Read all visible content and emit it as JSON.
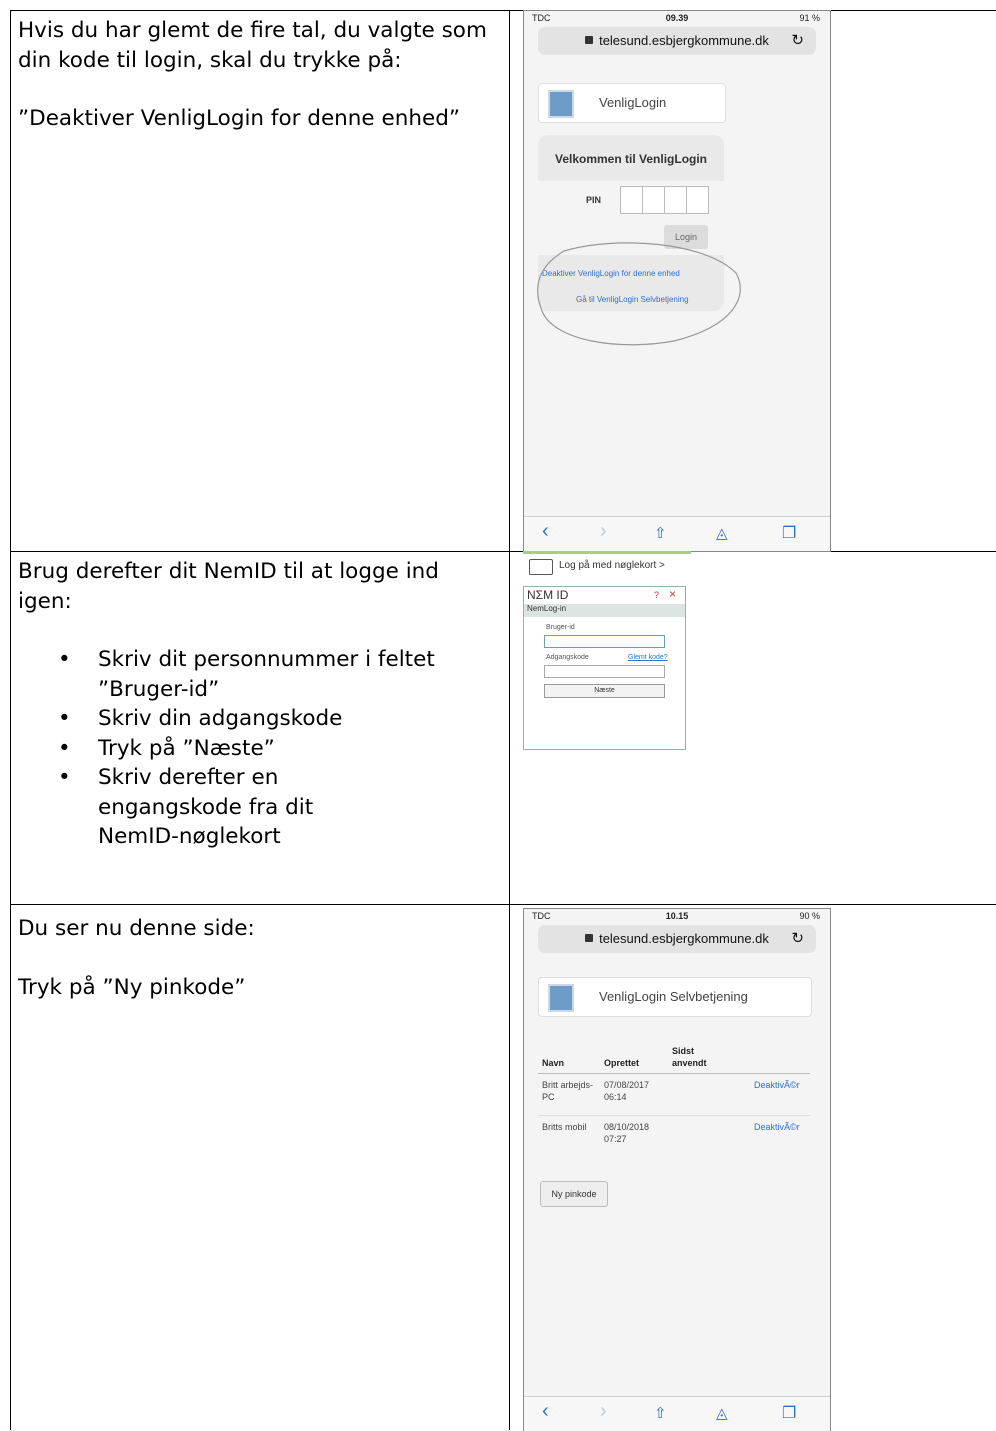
{
  "rows": [
    {
      "text_paragraphs": [
        "Hvis du har glemt de fire tal, du valgte som din kode til login, skal du trykke på:",
        "”Deaktiver VenligLogin for denne enhed”"
      ]
    },
    {
      "intro": "Brug derefter dit NemID til at logge ind igen:",
      "bullets": [
        "Skriv dit personnummer i feltet ”Bruger-id”",
        "Skriv din adgangskode",
        "Tryk på ”Næste”",
        "Skriv derefter en engangskode fra dit NemID-nøglekort"
      ]
    },
    {
      "text_paragraphs": [
        "Du ser nu denne side:",
        "Tryk på ”Ny pinkode”"
      ]
    }
  ],
  "phone1": {
    "carrier": "TDC",
    "time": "09.39",
    "battery": "91 %",
    "url": "telesund.esbjergkommune.dk",
    "reload_icon": "reload-icon",
    "brand": "VenligLogin",
    "welcome": "Velkommen til VenligLogin",
    "pin_label": "PIN",
    "login_button": "Login",
    "link_deactivate": "Deaktiver VenligLogin for denne enhed",
    "link_selfservice": "Gå til VenligLogin Selvbetjening"
  },
  "nemid": {
    "top_link": "Log på med nøglekort >",
    "logo": "NΣM ID",
    "help": "?",
    "close": "×",
    "subtitle": "NemLog-in",
    "user_label": "Bruger-id",
    "password_label": "Adgangskode",
    "forgot": "Glemt kode?",
    "next_button": "Næste"
  },
  "phone2": {
    "carrier": "TDC",
    "time": "10.15",
    "battery": "90 %",
    "url": "telesund.esbjergkommune.dk",
    "brand": "VenligLogin Selvbetjening",
    "col_name": "Navn",
    "col_created": "Oprettet",
    "col_used_1": "Sidst",
    "col_used_2": "anvendt",
    "devices": [
      {
        "name_1": "Britt arbejds-",
        "name_2": "PC",
        "date": "07/08/2017",
        "time": "06:14",
        "action": "DeaktivÃ©r"
      },
      {
        "name_1": "Britts mobil",
        "name_2": "",
        "date": "08/10/2018",
        "time": "07:27",
        "action": "DeaktivÃ©r"
      }
    ],
    "new_pin_button": "Ny pinkode"
  }
}
